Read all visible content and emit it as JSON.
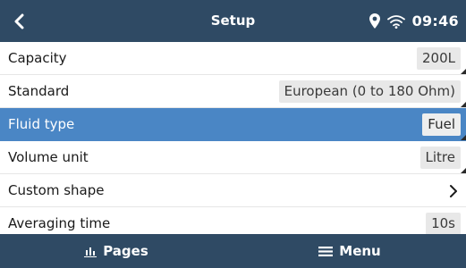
{
  "header": {
    "title": "Setup",
    "clock": "09:46",
    "icons": [
      "back-chevron-icon",
      "location-pin-icon",
      "wifi-icon"
    ]
  },
  "settings": [
    {
      "label": "Capacity",
      "value": "200L"
    },
    {
      "label": "Standard",
      "value": "European (0 to 180 Ohm)"
    },
    {
      "label": "Fluid type",
      "value": "Fuel",
      "selected": true
    },
    {
      "label": "Volume unit",
      "value": "Litre"
    },
    {
      "label": "Custom shape",
      "value": ""
    },
    {
      "label": "Averaging time",
      "value": "10s"
    }
  ],
  "footer": {
    "pages_label": "Pages",
    "menu_label": "Menu"
  },
  "colors": {
    "header_bg": "#2f4a64",
    "selected_row": "#4a86c5",
    "value_box": "#e8e8e8"
  }
}
